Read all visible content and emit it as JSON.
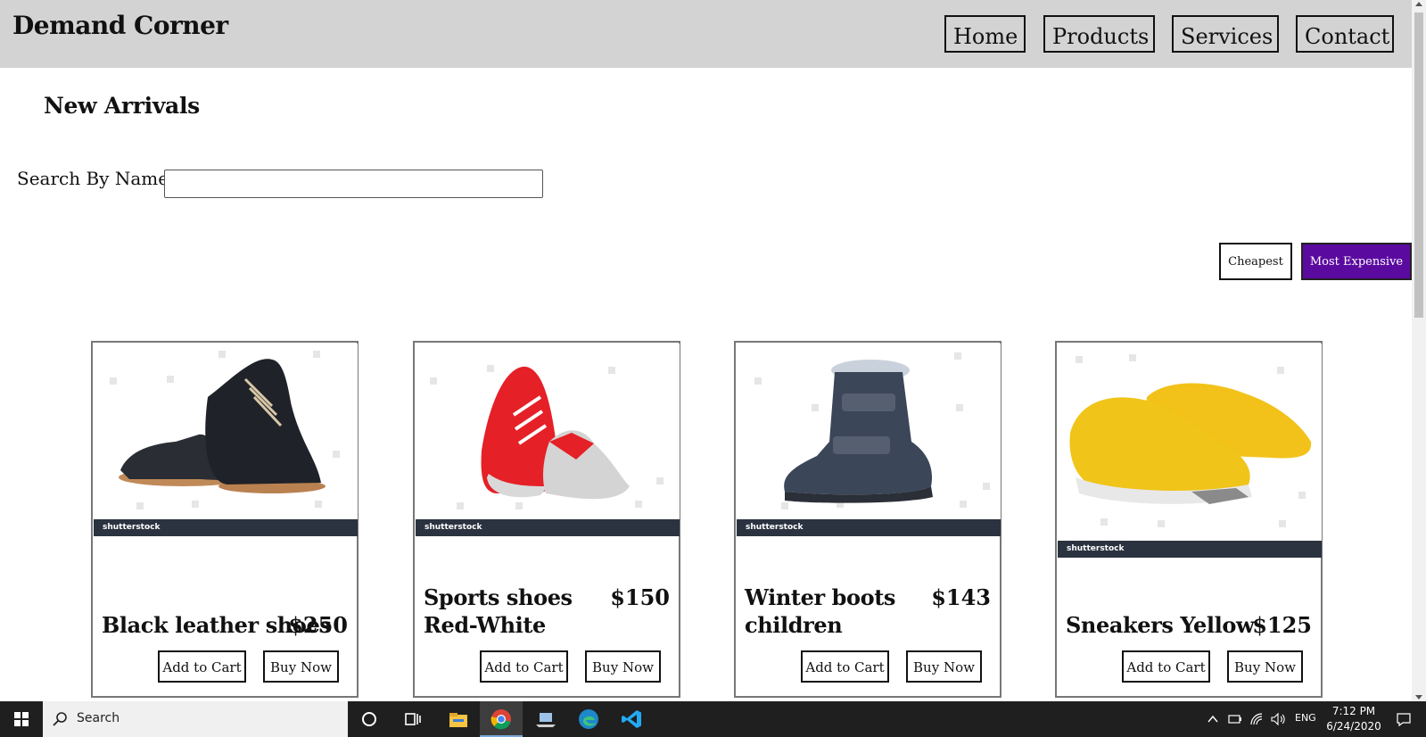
{
  "header": {
    "brand": "Demand Corner",
    "nav": [
      "Home",
      "Products",
      "Services",
      "Contact"
    ]
  },
  "main": {
    "section_title": "New Arrivals",
    "search_label": "Search By Name",
    "search_value": "",
    "sort": {
      "cheapest": "Cheapest",
      "most_expensive": "Most Expensive"
    },
    "accent_color": "#5b0aa0"
  },
  "products": [
    {
      "name": "Black leather shoes",
      "price": "$250",
      "add_to_cart": "Add to Cart",
      "buy_now": "Buy Now",
      "image_watermark": "shutterstock"
    },
    {
      "name": "Sports shoes Red-White",
      "price": "$150",
      "add_to_cart": "Add to Cart",
      "buy_now": "Buy Now",
      "image_watermark": "shutterstock"
    },
    {
      "name": "Winter boots children",
      "price": "$143",
      "add_to_cart": "Add to Cart",
      "buy_now": "Buy Now",
      "image_watermark": "shutterstock"
    },
    {
      "name": "Sneakers Yellow",
      "price": "$125",
      "add_to_cart": "Add to Cart",
      "buy_now": "Buy Now",
      "image_watermark": "shutterstock"
    }
  ],
  "taskbar": {
    "search_placeholder": "Search",
    "icons": [
      "windows-start-icon",
      "search-icon",
      "cortana-icon",
      "task-view-icon",
      "file-explorer-icon",
      "chrome-icon",
      "laptop-app-icon",
      "edge-icon",
      "vscode-icon"
    ],
    "language": "ENG",
    "time": "7:12 PM",
    "date": "6/24/2020"
  }
}
